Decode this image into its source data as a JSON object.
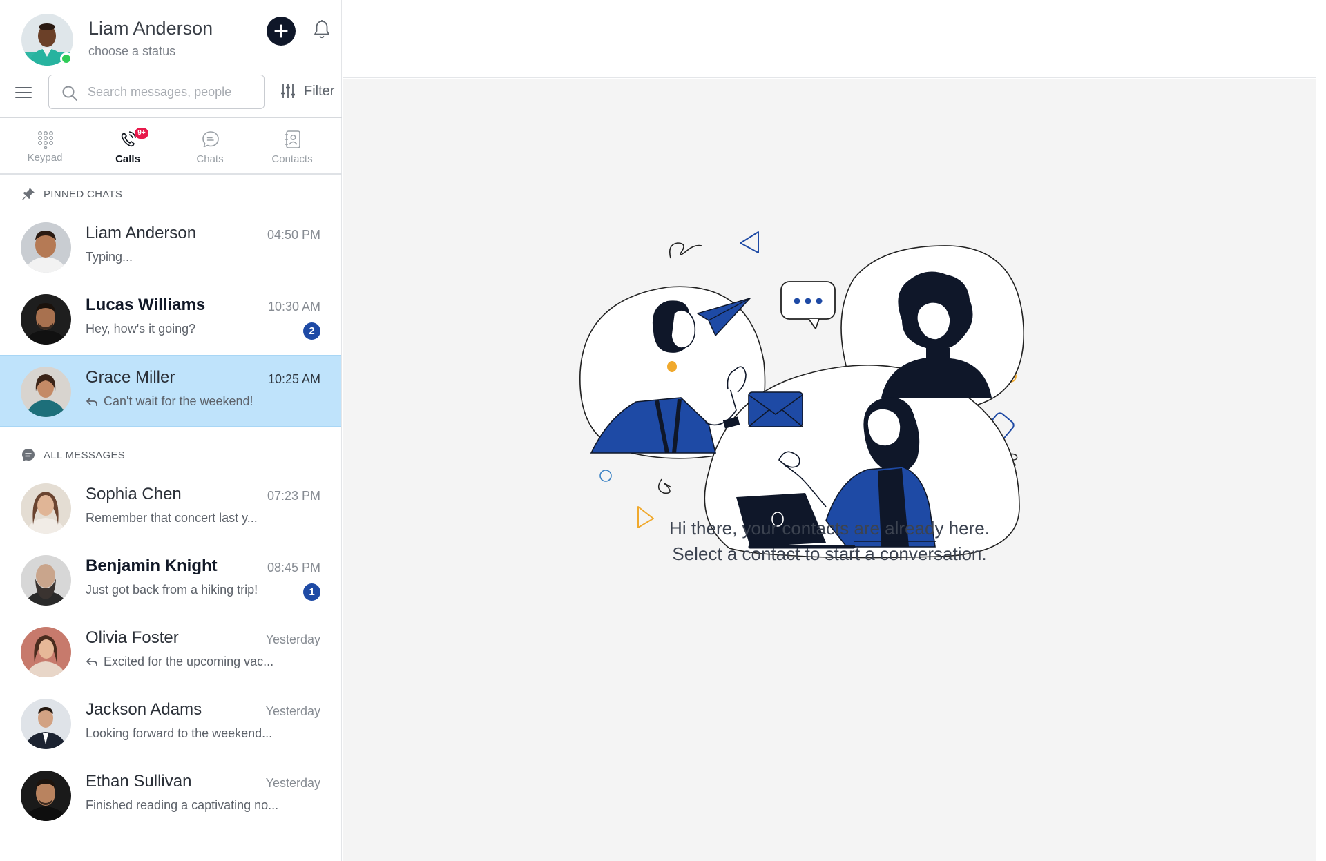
{
  "user": {
    "name": "Liam Anderson",
    "status_placeholder": "choose a status"
  },
  "search": {
    "placeholder": "Search messages, people"
  },
  "filter_label": "Filter",
  "tabs": [
    {
      "label": "Keypad",
      "active": false
    },
    {
      "label": "Calls",
      "active": true,
      "badge": "9+"
    },
    {
      "label": "Chats",
      "active": false
    },
    {
      "label": "Contacts",
      "active": false
    }
  ],
  "sections": {
    "pinned": "PINNED CHATS",
    "all": "ALL MESSAGES"
  },
  "pinned_chats": [
    {
      "name": "Liam Anderson",
      "time": "04:50 PM",
      "preview": "Typing...",
      "unread": false
    },
    {
      "name": "Lucas Williams",
      "time": "10:30 AM",
      "preview": "Hey, how's it going?",
      "unread": true,
      "count": "2"
    },
    {
      "name": "Grace Miller",
      "time": "10:25 AM",
      "preview": "Can't wait for the weekend!",
      "unread": false,
      "replied": true,
      "selected": true
    }
  ],
  "all_messages": [
    {
      "name": "Sophia Chen",
      "time": "07:23 PM",
      "preview": "Remember that concert last y...",
      "unread": false
    },
    {
      "name": "Benjamin Knight",
      "time": "08:45 PM",
      "preview": "Just got back from a hiking trip!",
      "unread": true,
      "count": "1"
    },
    {
      "name": "Olivia Foster",
      "time": "Yesterday",
      "preview": "Excited for the upcoming vac...",
      "unread": false,
      "replied": true
    },
    {
      "name": "Jackson Adams",
      "time": "Yesterday",
      "preview": "Looking forward to the weekend...",
      "unread": false
    },
    {
      "name": "Ethan Sullivan",
      "time": "Yesterday",
      "preview": "Finished reading a captivating no...",
      "unread": false
    }
  ],
  "empty_state": {
    "line1": "Hi there, your contacts are already here.",
    "line2": "Select a contact to start a conversation."
  },
  "colors": {
    "accent": "#1e4aa5",
    "selected_row": "#bfe3fb",
    "badge_red": "#e8194b",
    "online": "#2ecc57"
  }
}
